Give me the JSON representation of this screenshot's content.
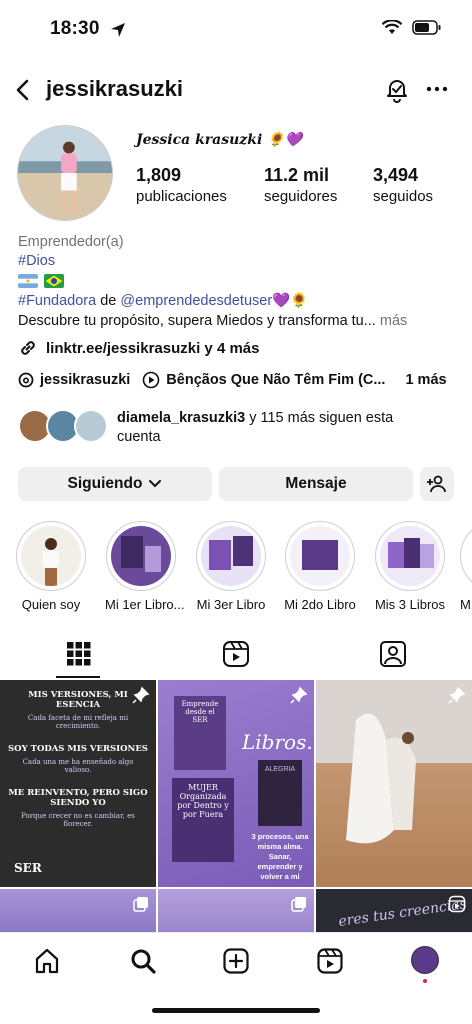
{
  "status": {
    "time": "18:30"
  },
  "header": {
    "username": "jessikrasuzki"
  },
  "profile": {
    "full_name": "Jessica krasuzki 🌻💜",
    "stats": [
      {
        "value": "1,809",
        "label": "publicaciones"
      },
      {
        "value": "11.2 mil",
        "label": "seguidores"
      },
      {
        "value": "3,494",
        "label": "seguidos"
      }
    ],
    "category": "Emprendedor(a)",
    "hashtag_dios": "#Dios",
    "hashtag_fundadora": "#Fundadora",
    "de": "de",
    "mention": "@emprendedesdetuser",
    "mention_emoji": "💜🌻",
    "bio_line": "Descubre tu propósito, supera Miedos y transforma tu...",
    "more": "más",
    "link_text": "linktr.ee/jessikrasuzki y 4 más",
    "threads_handle": "jessikrasuzki",
    "music_text": "Bênçãos Que Não Têm Fim (C...",
    "music_suffix": "1 más",
    "followed_by_name": "diamela_krasuzki3",
    "followed_by_rest": " y 115 más siguen esta",
    "followed_by_line2": "cuenta"
  },
  "buttons": {
    "following": "Siguiendo",
    "message": "Mensaje"
  },
  "highlights": [
    {
      "label": "Quien soy"
    },
    {
      "label": "Mi 1er Libro..."
    },
    {
      "label": "Mi 3er Libro"
    },
    {
      "label": "Mi 2do Libro"
    },
    {
      "label": "Mis 3 Libros"
    },
    {
      "label": "M"
    }
  ],
  "posts": {
    "post1": {
      "h1": "MIS VERSIONES, MI ESENCIA",
      "p1": "Cada faceta de mi refleja mi crecimiento.",
      "h2": "SOY TODAS MIS VERSIONES",
      "p2": "Cada una me ha enseñado algo valioso.",
      "h3": "ME REINVENTO, PERO SIGO SIENDO YO",
      "p3": "Porque crecer no es cambiar, es florecer.",
      "brand": "SER"
    },
    "post2": {
      "book1": "Emprende desde el SER",
      "libros": "Libros.",
      "book2": "MUJER Organizada por Dentro y por Fuera",
      "book3": "ALEGRIA",
      "caption": "3 procesos, una misma alma. Sanar, emprender y volver a mi"
    },
    "post6": {
      "text": "eres tus creencias"
    }
  },
  "colors": {
    "accent_link": "#4150a3",
    "purple": "#8b6cc6",
    "dark_purple": "#4a2f73"
  }
}
